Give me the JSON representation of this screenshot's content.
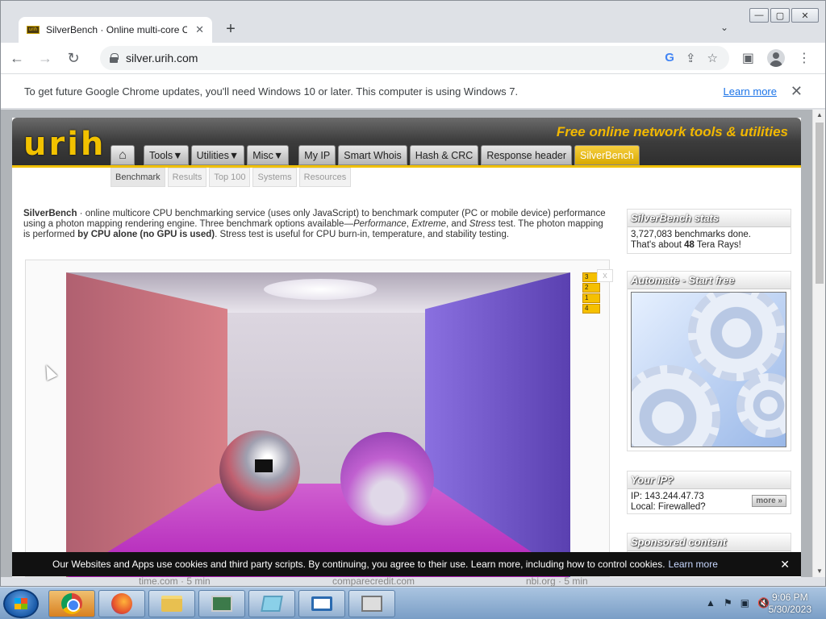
{
  "window": {
    "controls": {
      "minimize": "—",
      "maximize": "▢",
      "close": "✕"
    }
  },
  "tab": {
    "title": "SilverBench · Online multi-core C",
    "close": "✕",
    "new_tab": "+",
    "search": "⌄",
    "favicon_text": "urih"
  },
  "toolbar": {
    "back": "←",
    "forward": "→",
    "reload": "↻",
    "url": "silver.urih.com",
    "icons": [
      "G",
      "⇪",
      "☆"
    ],
    "right_icons": [
      "▣",
      "⋮"
    ]
  },
  "infobar": {
    "message": "To get future Google Chrome updates, you'll need Windows 10 or later. This computer is using Windows 7.",
    "learn_more": "Learn more",
    "close": "✕"
  },
  "site": {
    "logo": "urih",
    "tagline": "Free online  network tools & utilities",
    "home_icon": "⌂",
    "nav": [
      "Tools▼",
      "Utilities▼",
      "Misc▼",
      "My IP",
      "Smart Whois",
      "Hash & CRC",
      "Response header",
      "SilverBench"
    ],
    "active_nav": "SilverBench",
    "subnav": [
      "Benchmark",
      "Results",
      "Top 100",
      "Systems",
      "Resources"
    ],
    "active_subnav": "Benchmark"
  },
  "intro": {
    "brand": "SilverBench",
    "part1": " · online multicore CPU benchmarking service (uses only JavaScript) to benchmark computer (PC or mobile device) performance using a photon mapping rendering engine. Three benchmark options available—",
    "opt1": "Performance",
    "sep1": ", ",
    "opt2": "Extreme",
    "sep2": ", and ",
    "opt3": "Stress",
    "part2": " test. The photon mapping is performed ",
    "bold": "by CPU alone (no GPU is used)",
    "part3": ". Stress test is useful for CPU burn-in, temperature, and stability testing."
  },
  "benchmark": {
    "legend": [
      "3",
      "2",
      "1",
      "4"
    ],
    "close": "x"
  },
  "sidebar": {
    "stats": {
      "title": "SilverBench stats",
      "line1": "3,727,083 benchmarks done.",
      "line2_pre": "That's about ",
      "line2_bold": "48",
      "line2_post": " Tera Rays!"
    },
    "automate": {
      "title": "Automate - Start free"
    },
    "ip": {
      "title": "Your IP?",
      "ip_line": "IP: 143.244.47.73",
      "local_line": "Local: Firewalled?",
      "more": "more »"
    },
    "sponsored": {
      "title": "Sponsored content"
    }
  },
  "cookie": {
    "message": "Our Websites and Apps use cookies and third party scripts. By continuing, you agree to their use. Learn more, including how to control cookies.",
    "link": "Learn more",
    "close": "✕"
  },
  "peek": [
    "time.com · 5 min",
    "comparecredit.com",
    "nbi.org · 5 min"
  ],
  "taskbar": {
    "tray_icons": [
      "▲",
      "⚑",
      "▣",
      "🔇"
    ],
    "time": "9:06 PM",
    "date": "5/30/2023"
  }
}
